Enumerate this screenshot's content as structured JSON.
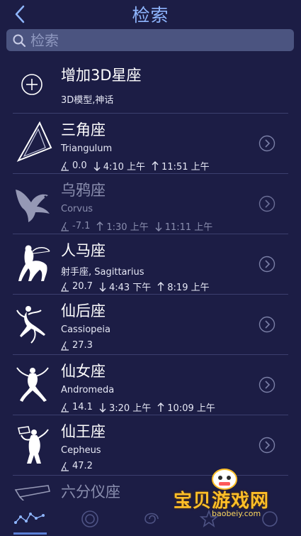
{
  "header": {
    "title": "检索"
  },
  "search": {
    "placeholder": "检索"
  },
  "add_row": {
    "title": "增加3D星座",
    "subtitle": "3D模型,神话"
  },
  "constellations": [
    {
      "name": "三角座",
      "latin": "Triangulum",
      "altitude": "0.0",
      "set_time": "4:10 上午",
      "rise_time": "11:51 上午",
      "dim": false
    },
    {
      "name": "乌鸦座",
      "latin": "Corvus",
      "altitude": "-7.1",
      "rise_time": "1:30 上午",
      "set_time": "11:11 上午",
      "dim": true
    },
    {
      "name": "人马座",
      "latin": "射手座, Sagittarius",
      "altitude": "20.7",
      "set_time": "4:43 下午",
      "rise_time": "8:19 上午",
      "dim": false
    },
    {
      "name": "仙后座",
      "latin": "Cassiopeia",
      "altitude": "27.3",
      "dim": false
    },
    {
      "name": "仙女座",
      "latin": "Andromeda",
      "altitude": "14.1",
      "set_time": "3:20 上午",
      "rise_time": "10:09 上午",
      "dim": false
    },
    {
      "name": "仙王座",
      "latin": "Cepheus",
      "altitude": "47.2",
      "dim": false
    },
    {
      "name": "六分仪座",
      "dim": true
    }
  ],
  "watermark": {
    "text": "宝贝游戏网",
    "url": "baobeiy.com"
  },
  "icons": {
    "back": "chevron-left-icon",
    "search": "search-icon",
    "add": "plus-circle-icon",
    "altitude": "altitude-angle-icon",
    "arrow_down": "arrow-down-icon",
    "arrow_up": "arrow-up-icon",
    "chevron": "chevron-right-circle-icon"
  },
  "colors": {
    "background": "#1c1d45",
    "accent": "#8fb6ff",
    "search_bg": "#4b5480",
    "tab_active": "#5b7fd6"
  }
}
